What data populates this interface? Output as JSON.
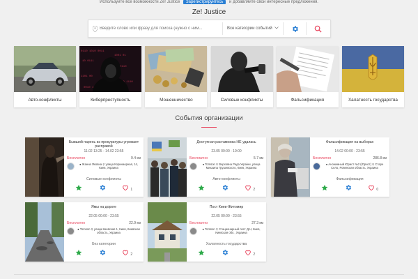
{
  "topline": {
    "text_left": "Используйте все возможности Ze! Justice",
    "register": "Зарегистрируйтесь",
    "text_right": "и добавляйте свои интересные предложения."
  },
  "site_title": "Ze! Justice",
  "search": {
    "placeholder": "Введите слово или фразу для поиска (нужно с ним...",
    "category_value": "Все категории событий",
    "icons": [
      "location-pin-icon",
      "gear-icon",
      "search-icon"
    ]
  },
  "colors": {
    "accent": "#e8415a",
    "blue": "#2a7fd4",
    "green": "#2eaa4a"
  },
  "categories": [
    {
      "label": "Авто-конфликты",
      "image": "car"
    },
    {
      "label": "Киберпреступность",
      "image": "hacker"
    },
    {
      "label": "Мошенничество",
      "image": "money"
    },
    {
      "label": "Силовые конфликты",
      "image": "fight"
    },
    {
      "label": "Фальсификация",
      "image": "document"
    },
    {
      "label": "Халатность государства",
      "image": "ukraine-flag"
    }
  ],
  "section_title": "События организации",
  "events": [
    {
      "title": "Бывший парень из прокуратуры угрожает расправой",
      "datetime": "11.02 13:25 - 14.02 23:55",
      "price": "Бесплатно",
      "distance": "9.4 км",
      "organizer": "Жанна Яковна",
      "address": "улица Коринаерная, 14, Киев, Украина",
      "category": "Силовые конфликты",
      "likes": "1"
    },
    {
      "title": "Доступная растаможка НЕ удалась",
      "datetime": "23.05 09:00 - 19:00",
      "price": "Бесплатно",
      "distance": "5.7 км",
      "organizer": "Tomson",
      "address": "Верховна Рада Украіни, улица Михаила Грушевского, Киев, Украина",
      "category": "Авто-конфликты",
      "likes": "2"
    },
    {
      "title": "Фальсификация на выборах",
      "datetime": "14.02 00:00 - 23:55",
      "price": "Бесплатно",
      "distance": "286.8 км",
      "organizer": "Анонимный Юрист №2 (Юрист)",
      "address": "Старе Село, Ровенская область, Украина",
      "category": "Фальсификация",
      "likes": "0"
    },
    {
      "title": "Ямы на дороге",
      "datetime": "22.05 00:00 - 23:55",
      "price": "Бесплатно",
      "distance": "22.9 км",
      "organizer": "Tomson",
      "address": "улица Киевская 1, Киев, Киевская область, Украина",
      "category": "Без категории",
      "likes": "2"
    },
    {
      "title": "Пост Киев-Житомир",
      "datetime": "22.05 00:00 - 23:55",
      "price": "Бесплатно",
      "distance": "27.3 км",
      "organizer": "Tomson",
      "address": "Стационарный пост ДАІ, Киев, Киевская обл., Украина",
      "category": "Халатность государства",
      "likes": "2"
    }
  ]
}
